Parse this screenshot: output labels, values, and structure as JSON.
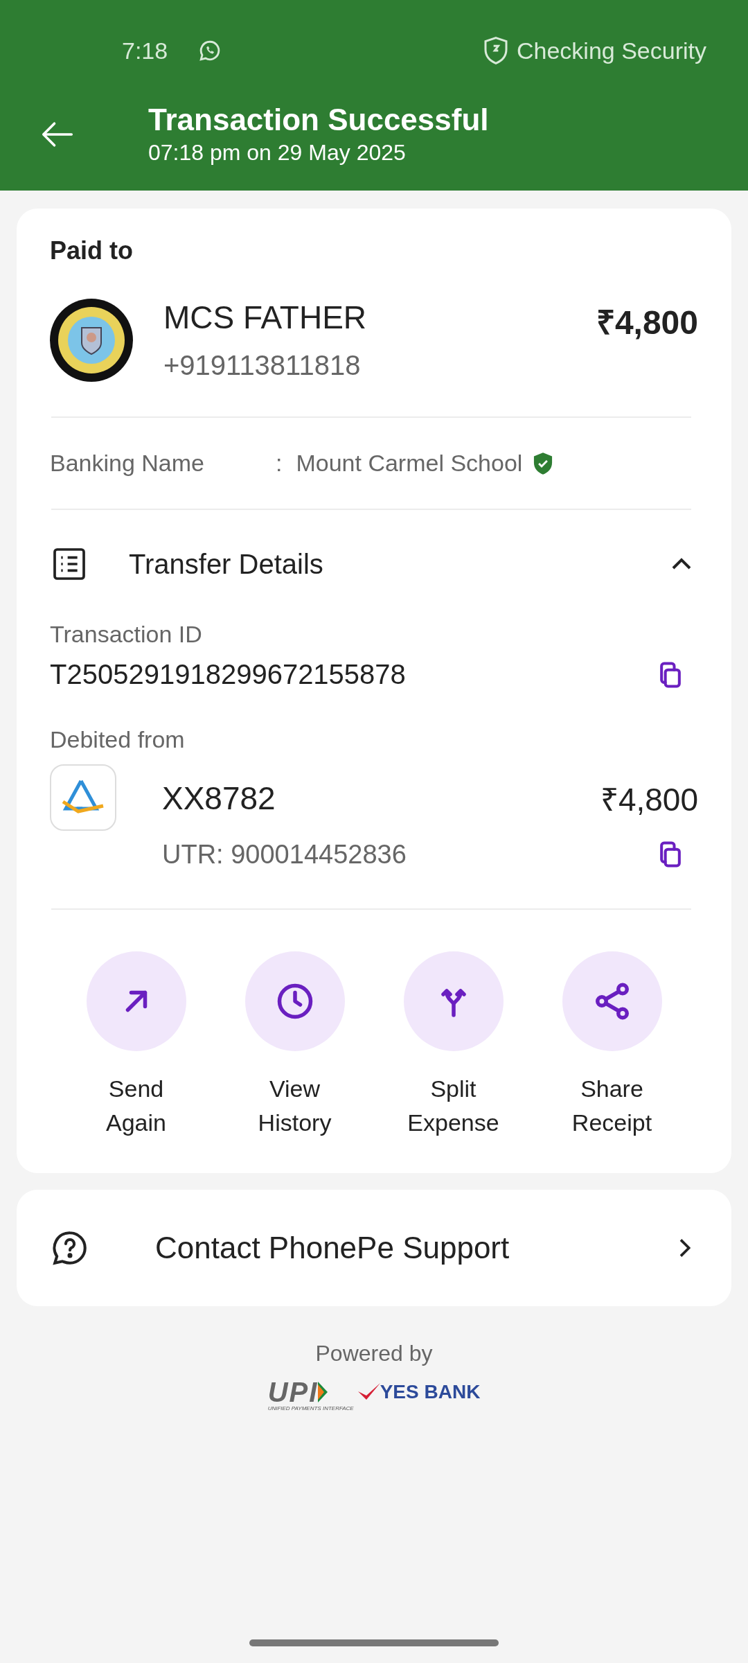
{
  "status_bar": {
    "time": "7:18",
    "security": "Checking Security"
  },
  "header": {
    "title": "Transaction Successful",
    "subtitle": "07:18 pm on 29 May 2025"
  },
  "payee": {
    "heading": "Paid to",
    "name": "MCS FATHER",
    "phone": "+919113811818",
    "amount": "₹4,800"
  },
  "banking_name": {
    "label": "Banking Name",
    "separator": ":",
    "value": "Mount Carmel School",
    "verified": true
  },
  "transfer_details": {
    "title": "Transfer Details",
    "expanded": true,
    "transaction_id_label": "Transaction ID",
    "transaction_id": "T2505291918299672155878",
    "debited_label": "Debited from",
    "account": "XX8782",
    "amount": "₹4,800",
    "utr": "UTR: 900014452836"
  },
  "actions": [
    {
      "kind": "send",
      "line1": "Send",
      "line2": "Again"
    },
    {
      "kind": "history",
      "line1": "View",
      "line2": "History"
    },
    {
      "kind": "split",
      "line1": "Split",
      "line2": "Expense"
    },
    {
      "kind": "share",
      "line1": "Share",
      "line2": "Receipt"
    }
  ],
  "support": {
    "label": "Contact PhonePe Support"
  },
  "footer": {
    "powered_by": "Powered by",
    "upi": "UPI",
    "upi_tagline": "UNIFIED PAYMENTS INTERFACE",
    "bank": "YES BANK"
  }
}
